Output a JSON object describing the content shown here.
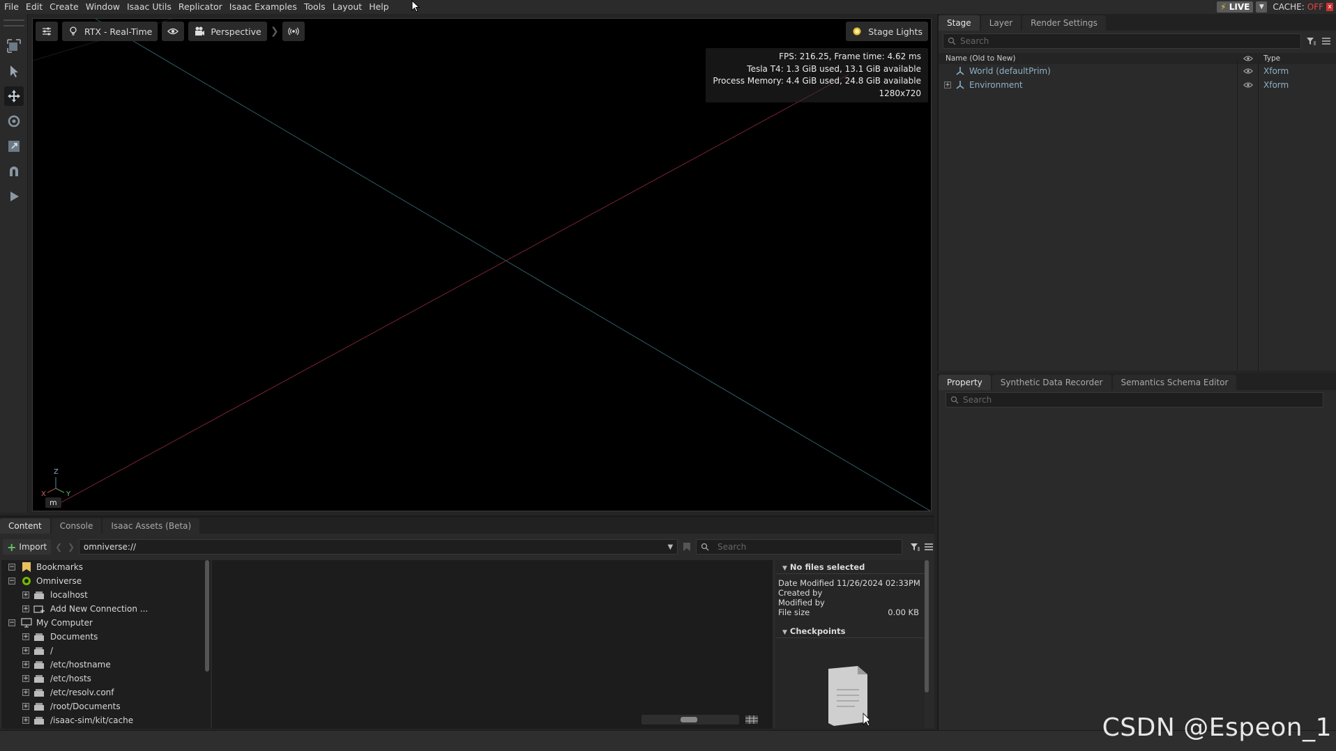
{
  "menubar": {
    "items": [
      "File",
      "Edit",
      "Create",
      "Window",
      "Isaac Utils",
      "Replicator",
      "Isaac Examples",
      "Tools",
      "Layout",
      "Help"
    ],
    "live_label": "LIVE",
    "cache_label": "CACHE:",
    "cache_state": "OFF"
  },
  "viewport": {
    "renderer_label": "RTX - Real-Time",
    "camera_label": "Perspective",
    "stage_lights_label": "Stage Lights",
    "stats": {
      "fps": "FPS: 216.25, Frame time: 4.62 ms",
      "gpu": "Tesla T4: 1.3 GiB used, 13.1 GiB available",
      "process_memory": "Process Memory: 4.4 GiB used, 24.8 GiB available",
      "resolution": "1280x720"
    },
    "axis_labels": {
      "z": "Z",
      "x": "X",
      "y": "Y"
    },
    "unit": "m"
  },
  "stage_panel": {
    "tabs": [
      "Stage",
      "Layer",
      "Render Settings"
    ],
    "search_placeholder": "Search",
    "columns": {
      "name": "Name (Old to New)",
      "type": "Type"
    },
    "rows": [
      {
        "name": "World (defaultPrim)",
        "type": "Xform"
      },
      {
        "name": "Environment",
        "type": "Xform"
      }
    ]
  },
  "property_panel": {
    "tabs": [
      "Property",
      "Synthetic Data Recorder",
      "Semantics Schema Editor"
    ],
    "search_placeholder": "Search"
  },
  "content_panel": {
    "tabs": [
      "Content",
      "Console",
      "Isaac Assets (Beta)"
    ],
    "import_label": "Import",
    "path_value": "omniverse://",
    "search_placeholder": "Search",
    "tree": [
      {
        "label": "Bookmarks"
      },
      {
        "label": "Omniverse"
      },
      {
        "label": "localhost"
      },
      {
        "label": "Add New Connection ..."
      },
      {
        "label": "My Computer"
      },
      {
        "label": "Documents"
      },
      {
        "label": "/"
      },
      {
        "label": "/etc/hostname"
      },
      {
        "label": "/etc/hosts"
      },
      {
        "label": "/etc/resolv.conf"
      },
      {
        "label": "/root/Documents"
      },
      {
        "label": "/isaac-sim/kit/cache"
      }
    ],
    "info": {
      "no_files_label": "No files selected",
      "date_modified_label": "Date Modified",
      "date_modified_value": "11/26/2024 02:33PM",
      "created_by_label": "Created by",
      "modified_by_label": "Modified by",
      "file_size_label": "File size",
      "file_size_value": "0.00 KB",
      "checkpoints_label": "Checkpoints"
    }
  },
  "watermark": "CSDN @Espeon_1",
  "colors": {
    "accent_live": "#f2c230",
    "cache_off": "#e04848",
    "prim_text": "#8fb1c8",
    "grid_red": "#a03040",
    "grid_teal": "#3a7a80"
  }
}
